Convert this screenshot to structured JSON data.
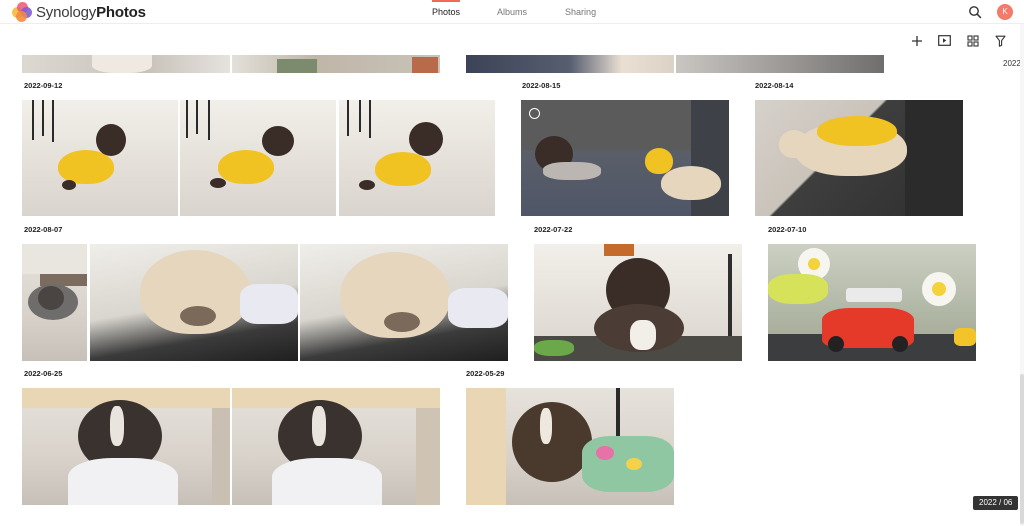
{
  "app": {
    "logo_prefix": "Synology",
    "logo_bold": "Photos",
    "avatar_letter": "K"
  },
  "tabs": [
    {
      "label": "Photos",
      "active": true
    },
    {
      "label": "Albums",
      "active": false
    },
    {
      "label": "Sharing",
      "active": false
    }
  ],
  "toolbar": {
    "icons": [
      "plus-icon",
      "slideshow-icon",
      "grid-view-icon",
      "filter-icon"
    ]
  },
  "timeline": {
    "year_label": "2022",
    "current_position": "2022 / 06"
  },
  "groups": [
    {
      "date": "2022-09-12",
      "photo_count": 3
    },
    {
      "date": "2022-08-15",
      "photo_count": 1
    },
    {
      "date": "2022-08-14",
      "photo_count": 1
    },
    {
      "date": "2022-08-07",
      "photo_count": 3
    },
    {
      "date": "2022-07-22",
      "photo_count": 1
    },
    {
      "date": "2022-07-10",
      "photo_count": 1
    },
    {
      "date": "2022-06-25",
      "photo_count": 2
    },
    {
      "date": "2022-05-29",
      "photo_count": 1
    }
  ],
  "colors": {
    "accent": "#f06a5a",
    "avatar": "#f47a6a",
    "badge_bg": "#333333"
  }
}
